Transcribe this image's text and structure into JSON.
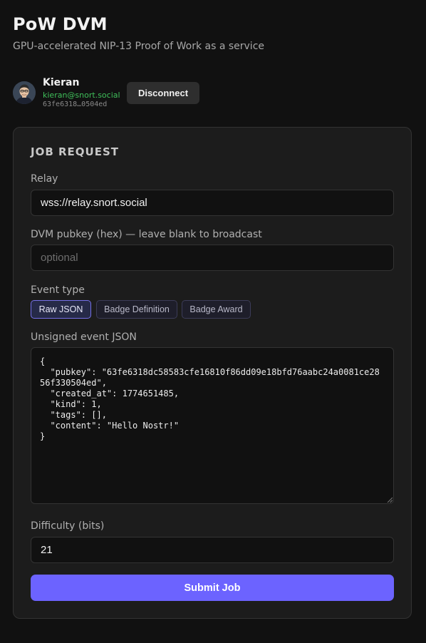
{
  "header": {
    "title": "PoW DVM",
    "subtitle": "GPU-accelerated NIP-13 Proof of Work as a service"
  },
  "user": {
    "avatar_icon": "avatar-portrait-icon",
    "name": "Kieran",
    "nip05": "kieran@snort.social",
    "npub_short": "63fe6318…0504ed",
    "disconnect_label": "Disconnect"
  },
  "job": {
    "title": "JOB REQUEST",
    "relay_label": "Relay",
    "relay_value": "wss://relay.snort.social",
    "pubkey_label": "DVM pubkey (hex) — leave blank to broadcast",
    "pubkey_placeholder": "optional",
    "pubkey_value": "",
    "event_type_label": "Event type",
    "event_types": [
      {
        "label": "Raw JSON",
        "active": true
      },
      {
        "label": "Badge Definition",
        "active": false
      },
      {
        "label": "Badge Award",
        "active": false
      }
    ],
    "json_label": "Unsigned event JSON",
    "json_value": "{\n  \"pubkey\": \"63fe6318dc58583cfe16810f86dd09e18bfd76aabc24a0081ce2856f330504ed\",\n  \"created_at\": 1774651485,\n  \"kind\": 1,\n  \"tags\": [],\n  \"content\": \"Hello Nostr!\"\n}",
    "difficulty_label": "Difficulty (bits)",
    "difficulty_value": "21",
    "submit_label": "Submit Job"
  },
  "colors": {
    "background": "#111111",
    "card": "#1c1c1c",
    "accent": "#6c63ff",
    "nip05_green": "#3fbf5a"
  }
}
